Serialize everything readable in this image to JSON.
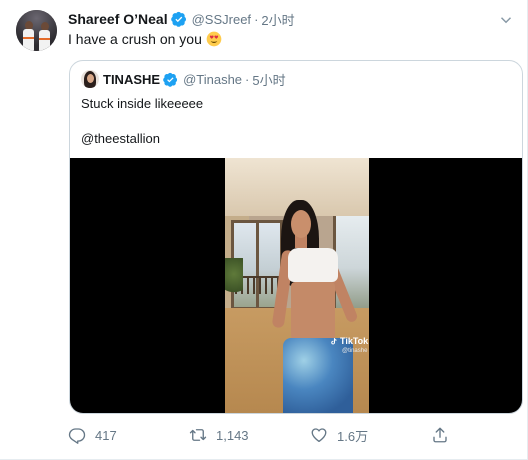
{
  "tweet": {
    "author_name": "Shareef O’Neal",
    "handle": "@SSJreef",
    "separator": "·",
    "time": "2小时",
    "text": "I have a crush on you",
    "emoji": "smiling-face-with-heart-eyes-emoji",
    "accent_color": "#1da1f2"
  },
  "quoted_tweet": {
    "author_name": "TINASHE",
    "handle": "@Tinashe",
    "separator": "·",
    "time": "5小时",
    "text_line1": "Stuck inside likeeeee",
    "text_line2": "@theestallion",
    "video": {
      "watermark": "TikTok",
      "watermark_user": "@tinashe"
    }
  },
  "actions": {
    "reply_count": "417",
    "retweet_count": "1,143",
    "like_count": "1.6万",
    "reply_icon": "reply-icon",
    "retweet_icon": "retweet-icon",
    "like_icon": "heart-icon",
    "share_icon": "share-icon"
  }
}
